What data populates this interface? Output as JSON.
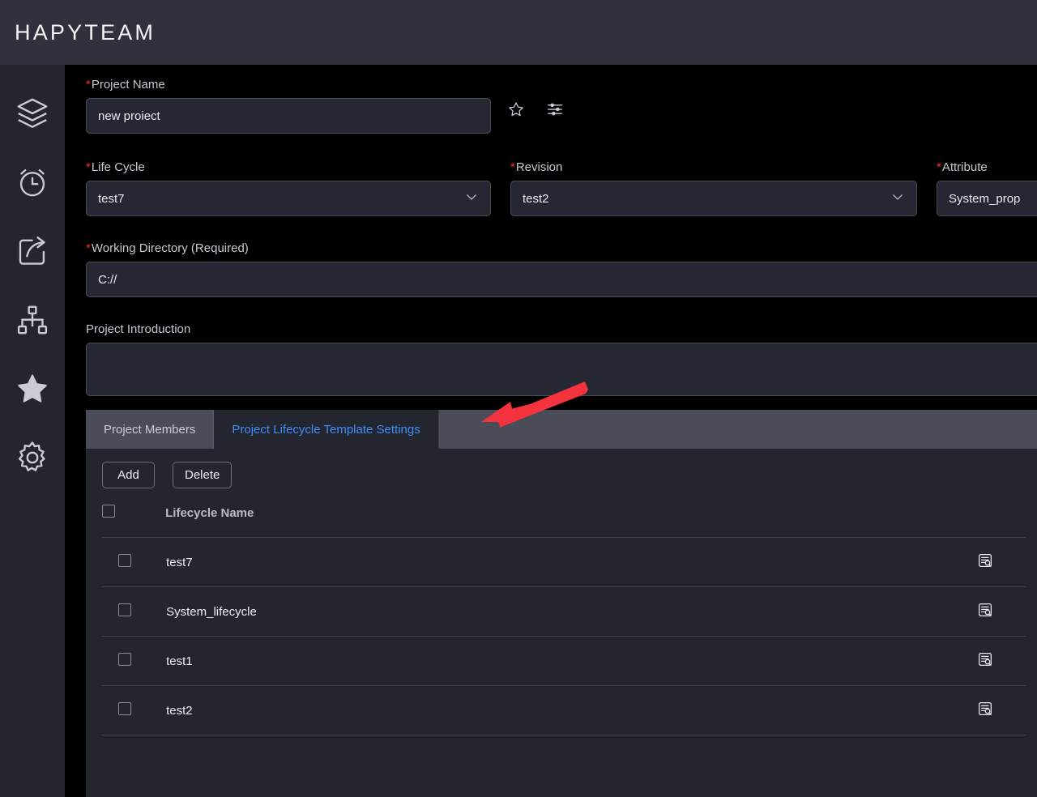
{
  "app": {
    "brand": "HAPYTEAM",
    "accent_blue": "#3b8ffd",
    "required_red": "#ff2d2d",
    "annotation_red": "#f5333f",
    "header_bg": "#2f313c",
    "panel_bg": "#24262f",
    "field_bg": "#252733",
    "page_bg": "#000000"
  },
  "sidebar": {
    "items": [
      {
        "icon": "layers-icon",
        "name": "sidebar-item-layers"
      },
      {
        "icon": "alarm-clock-icon",
        "name": "sidebar-item-alarm"
      },
      {
        "icon": "share-export-icon",
        "name": "sidebar-item-share"
      },
      {
        "icon": "sitemap-icon",
        "name": "sidebar-item-sitemap"
      },
      {
        "icon": "star-filled-icon",
        "name": "sidebar-item-favorites"
      },
      {
        "icon": "gear-icon",
        "name": "sidebar-item-settings"
      }
    ]
  },
  "form": {
    "project_name": {
      "label": "Project Name",
      "required": true,
      "value": "new proiect",
      "placeholder": "Project Name"
    },
    "favorite_icon": "star-outline-icon",
    "filter_icon": "sliders-icon",
    "life_cycle": {
      "label": "Life Cycle",
      "required": true,
      "value": "test7",
      "chevron": "chevron-down-icon"
    },
    "revision": {
      "label": "Revision",
      "required": true,
      "value": "test2",
      "chevron": "chevron-down-icon"
    },
    "attribute": {
      "label": "Attribute",
      "required": true,
      "value": "System_prop"
    },
    "working_directory": {
      "label": "Working Directory (Required)",
      "required": true,
      "value": "C://",
      "placeholder": "Working Directory"
    },
    "project_introduction": {
      "label": "Project Introduction",
      "required": false,
      "value": "",
      "placeholder": ""
    }
  },
  "tabs": [
    {
      "label": "Project Members",
      "active": false,
      "name": "tab-project-members"
    },
    {
      "label": "Project Lifecycle Template Settings",
      "active": true,
      "name": "tab-project-lifecycle-template-settings"
    }
  ],
  "toolbar": {
    "add_label": "Add",
    "delete_label": "Delete"
  },
  "table": {
    "columns": [
      "Lifecycle Name"
    ],
    "header_checkbox_checked": false,
    "row_action_icon": "document-search-icon",
    "rows": [
      {
        "checked": false,
        "lifecycle_name": "test7"
      },
      {
        "checked": false,
        "lifecycle_name": "System_lifecycle"
      },
      {
        "checked": false,
        "lifecycle_name": "test1"
      },
      {
        "checked": false,
        "lifecycle_name": "test2"
      }
    ]
  },
  "annotation": {
    "type": "arrow",
    "points_to": "tab-project-lifecycle-template-settings",
    "color": "#f5333f"
  }
}
